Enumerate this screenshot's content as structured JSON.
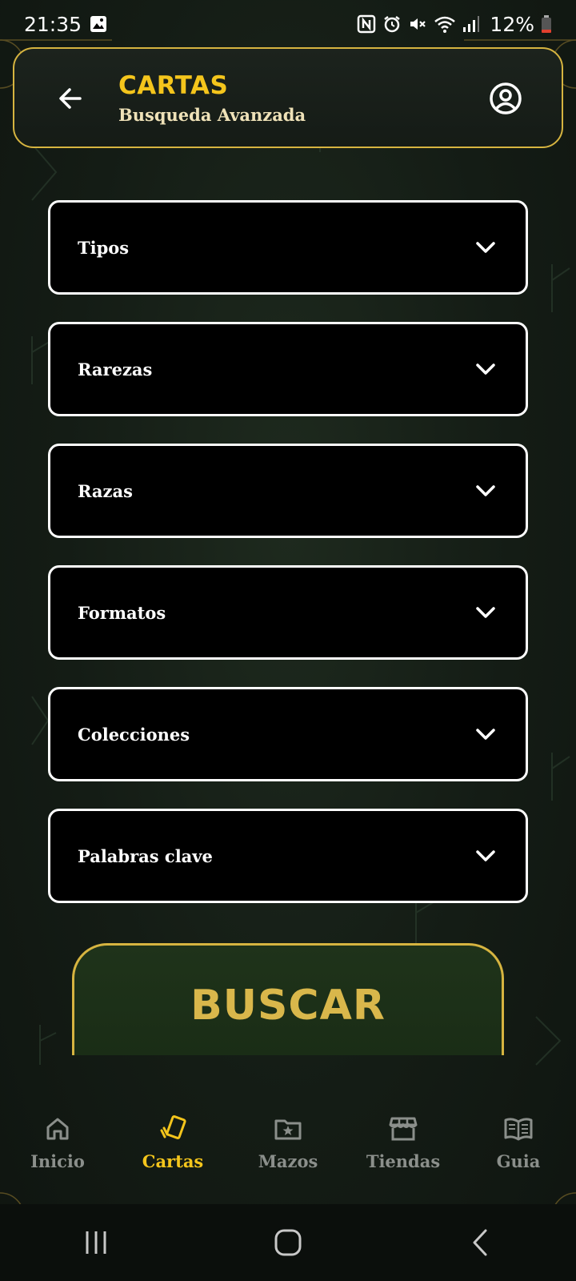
{
  "status_bar": {
    "time": "21:35",
    "battery": "12%",
    "icons": [
      "image-icon",
      "nfc-icon",
      "alarm-icon",
      "mute-icon",
      "wifi-icon",
      "signal-icon",
      "battery-icon"
    ]
  },
  "header": {
    "title": "CARTAS",
    "subtitle": "Busqueda Avanzada",
    "back_icon": "arrow-left-icon",
    "profile_icon": "user-circle-icon"
  },
  "filters": [
    {
      "label": "Tipos"
    },
    {
      "label": "Rarezas"
    },
    {
      "label": "Razas"
    },
    {
      "label": "Formatos"
    },
    {
      "label": "Colecciones"
    },
    {
      "label": "Palabras clave"
    }
  ],
  "search_button": {
    "label": "BUSCAR"
  },
  "bottom_nav": {
    "active": "Cartas",
    "items": [
      {
        "label": "Inicio",
        "icon": "home-icon"
      },
      {
        "label": "Cartas",
        "icon": "cards-icon"
      },
      {
        "label": "Mazos",
        "icon": "folder-star-icon"
      },
      {
        "label": "Tiendas",
        "icon": "store-icon"
      },
      {
        "label": "Guia",
        "icon": "book-icon"
      }
    ]
  },
  "colors": {
    "accent": "#f4c51c",
    "border_gold": "#d6b440",
    "button_text": "#d9b74b",
    "inactive": "#8b8f8b"
  }
}
